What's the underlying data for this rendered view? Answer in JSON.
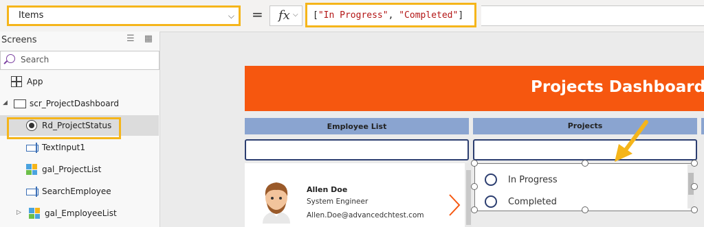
{
  "formula_bar": {
    "property": "Items",
    "equals": "=",
    "fx_label": "fx",
    "formula_open": "[",
    "formula_str1": "\"In Progress\"",
    "formula_sep": ", ",
    "formula_str2": "\"Completed\"",
    "formula_close": "]"
  },
  "tree_panel": {
    "title": "Screens",
    "search_placeholder": "Search",
    "items": [
      {
        "label": "App",
        "icon": "app-icon"
      },
      {
        "label": "scr_ProjectDashboard",
        "icon": "screen-icon"
      },
      {
        "label": "Rd_ProjectStatus",
        "icon": "radio-icon"
      },
      {
        "label": "TextInput1",
        "icon": "text-input-icon"
      },
      {
        "label": "gal_ProjectList",
        "icon": "gallery-icon"
      },
      {
        "label": "SearchEmployee",
        "icon": "text-input-icon"
      },
      {
        "label": "gal_EmployeeList",
        "icon": "gallery-icon"
      }
    ]
  },
  "canvas": {
    "header_title": "Projects  Dashboard",
    "col_employee": "Employee  List",
    "col_projects": "Projects",
    "employee": {
      "name": "Allen Doe",
      "role": "System Engineer",
      "email": "Allen.Doe@advancedchtest.com"
    },
    "radio_options": [
      "In Progress",
      "Completed"
    ]
  },
  "colors": {
    "accent_highlight": "#f5b51a",
    "header": "#f6570f",
    "column_header": "#8aa4d0"
  }
}
